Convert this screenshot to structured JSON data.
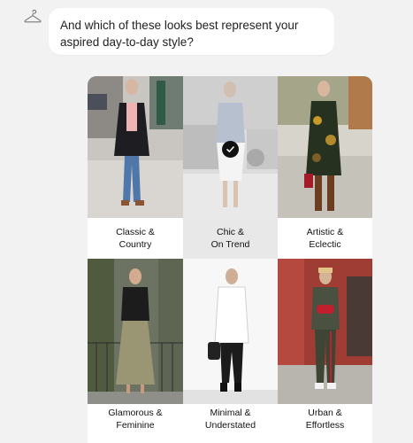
{
  "chat": {
    "bot_icon": "hanger-icon",
    "message": "And which of these looks best represent your aspired day-to-day style?"
  },
  "styles": [
    {
      "line1": "Classic &",
      "line2": "Country",
      "selected": false
    },
    {
      "line1": "Chic &",
      "line2": "On Trend",
      "selected": true
    },
    {
      "line1": "Artistic &",
      "line2": "Eclectic",
      "selected": false
    },
    {
      "line1": "Glamorous &",
      "line2": "Feminine",
      "selected": false
    },
    {
      "line1": "Minimal &",
      "line2": "Understated",
      "selected": false
    },
    {
      "line1": "Urban &",
      "line2": "Effortless",
      "selected": false
    }
  ],
  "selected_indicator_icon": "checkmark-icon"
}
